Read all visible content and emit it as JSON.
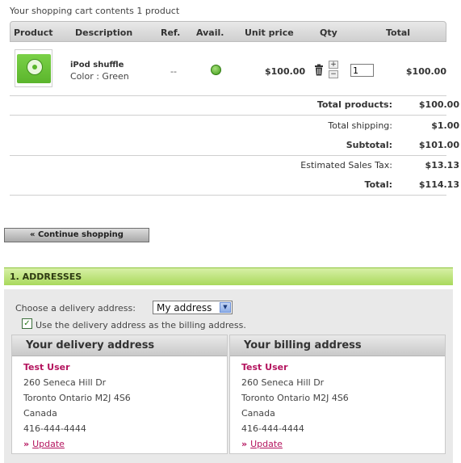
{
  "summary": "Your shopping cart contents 1 product",
  "cart": {
    "headers": {
      "product": "Product",
      "description": "Description",
      "ref": "Ref.",
      "avail": "Avail.",
      "unit_price": "Unit price",
      "qty": "Qty",
      "total": "Total"
    },
    "item": {
      "name": "iPod shuffle",
      "attribute": "Color : Green",
      "ref": "--",
      "unit_price": "$100.00",
      "qty": "1",
      "qty_up": "+",
      "qty_down": "−",
      "total": "$100.00"
    },
    "totals": {
      "products_label": "Total products:",
      "products_value": "$100.00",
      "shipping_label": "Total shipping:",
      "shipping_value": "$1.00",
      "subtotal_label": "Subtotal:",
      "subtotal_value": "$101.00",
      "tax_label": "Estimated Sales Tax:",
      "tax_value": "$13.13",
      "total_label": "Total:",
      "total_value": "$114.13"
    }
  },
  "continue_label": "« Continue shopping",
  "addresses": {
    "step_title": "1. ADDRESSES",
    "choose_label": "Choose a delivery address:",
    "selected_address": "My address",
    "billing_same_label": "Use the delivery address as the billing address.",
    "billing_same_checked": true,
    "delivery": {
      "title": "Your delivery address",
      "name": "Test User",
      "street": "260 Seneca Hill Dr",
      "city_line": "Toronto Ontario M2J 4S6",
      "country": "Canada",
      "phone": "416-444-4444",
      "update_label": "Update"
    },
    "billing": {
      "title": "Your billing address",
      "name": "Test User",
      "street": "260 Seneca Hill Dr",
      "city_line": "Toronto Ontario M2J 4S6",
      "country": "Canada",
      "phone": "416-444-4444",
      "update_label": "Update"
    }
  },
  "colors": {
    "accent_link": "#b4145e",
    "step_bar": "#a9d95c",
    "available": "#3f9a1a"
  }
}
